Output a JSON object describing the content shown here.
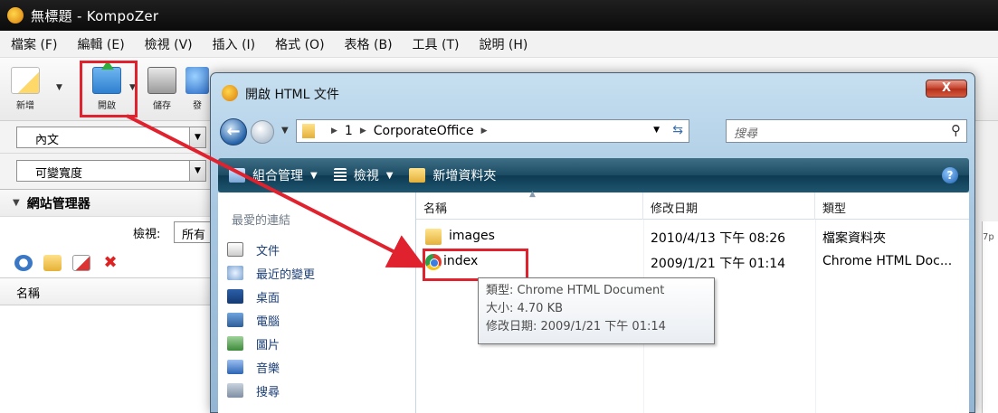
{
  "window": {
    "title": "無標題 - KompoZer"
  },
  "menubar": [
    "檔案 (F)",
    "編輯 (E)",
    "檢視 (V)",
    "插入 (I)",
    "格式 (O)",
    "表格 (B)",
    "工具 (T)",
    "說明 (H)"
  ],
  "toolbar": {
    "new_label": "新增",
    "open_label": "開啟",
    "save_label": "儲存",
    "publish_label": "發"
  },
  "format": {
    "paragraph_style": "內文",
    "font": "可變寬度"
  },
  "site_manager": {
    "title": "網站管理器",
    "view_label": "檢視:",
    "view_value": "所有",
    "column_name": "名稱"
  },
  "editor_clip_text": "7p",
  "dialog": {
    "title": "開啟 HTML 文件",
    "close_label": "X",
    "address": {
      "segments": [
        "1",
        "CorporateOffice"
      ]
    },
    "search_placeholder": "搜尋",
    "commands": {
      "organize": "組合管理",
      "views": "檢視",
      "new_folder": "新增資料夾"
    },
    "favorites_title": "最愛的連結",
    "nav_items": [
      "文件",
      "最近的變更",
      "桌面",
      "電腦",
      "圖片",
      "音樂",
      "搜尋"
    ],
    "columns": {
      "name": "名稱",
      "modified": "修改日期",
      "type": "類型"
    },
    "files": [
      {
        "name": "images",
        "modified": "2010/4/13 下午 08:26",
        "type": "檔案資料夾",
        "icon": "folder-icon"
      },
      {
        "name": "index",
        "modified": "2009/1/21 下午 01:14",
        "type": "Chrome HTML Doc...",
        "icon": "chrome-icon"
      }
    ],
    "tooltip": {
      "line1": "類型: Chrome HTML Document",
      "line2": "大小: 4.70 KB",
      "line3": "修改日期: 2009/1/21 下午 01:14"
    }
  },
  "colors": {
    "annotation_red": "#e0212e",
    "command_bar": "#1b4b63",
    "title_bar": "#111111"
  }
}
